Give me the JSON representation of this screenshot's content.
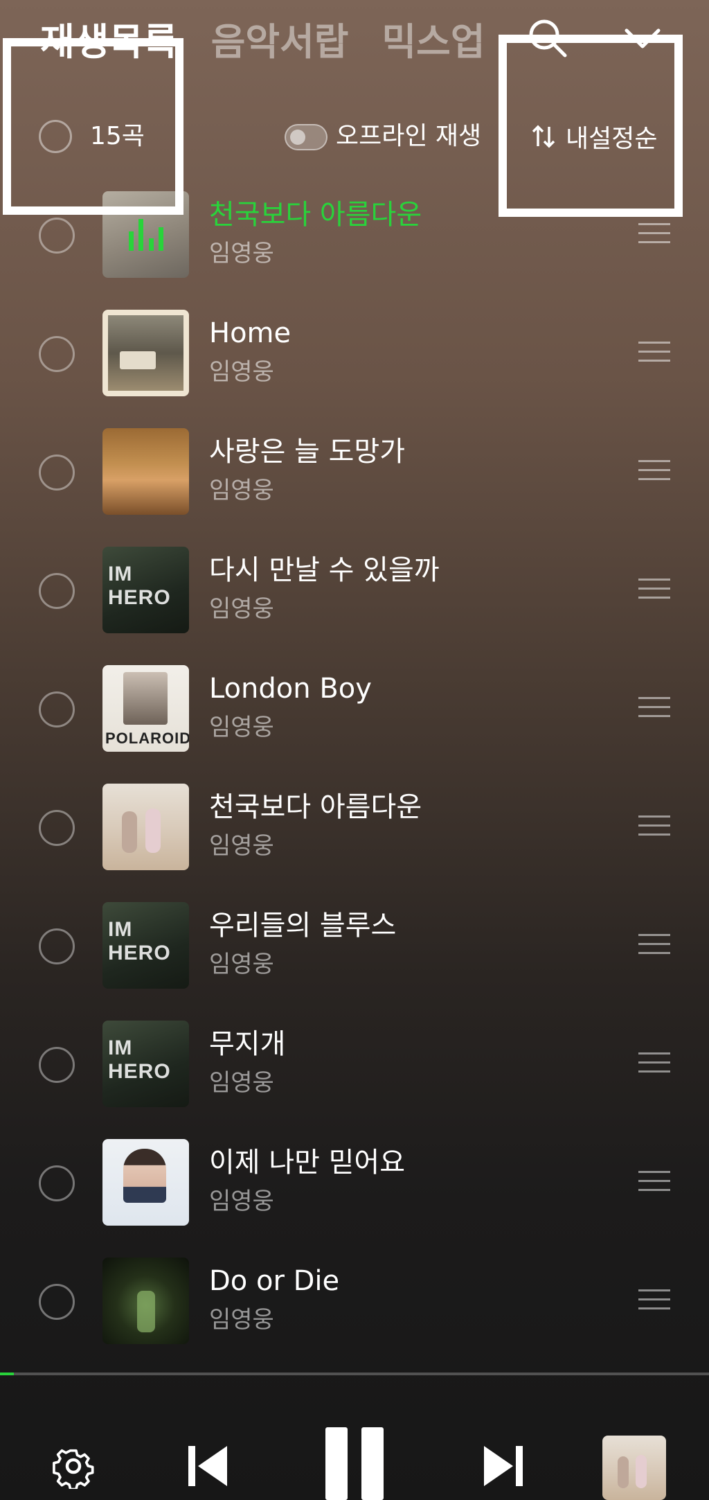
{
  "tabs": [
    {
      "label": "재생목록",
      "active": true
    },
    {
      "label": "음악서랍",
      "active": false
    },
    {
      "label": "믹스업",
      "active": false
    }
  ],
  "header": {
    "search_icon": "search-icon",
    "collapse_icon": "chevron-down-icon"
  },
  "list_header": {
    "count_label": "15곡",
    "offline_label": "오프라인 재생",
    "offline_enabled": false,
    "sort_label": "내설정순"
  },
  "tracks": [
    {
      "title": "천국보다 아름다운",
      "artist": "임영웅",
      "playing": true
    },
    {
      "title": "Home",
      "artist": "임영웅",
      "playing": false
    },
    {
      "title": "사랑은 늘 도망가",
      "artist": "임영웅",
      "playing": false
    },
    {
      "title": "다시 만날 수 있을까",
      "artist": "임영웅",
      "playing": false,
      "album_text": "IM HERO"
    },
    {
      "title": "London Boy",
      "artist": "임영웅",
      "playing": false,
      "album_text": "POLAROID"
    },
    {
      "title": "천국보다 아름다운",
      "artist": "임영웅",
      "playing": false
    },
    {
      "title": "우리들의 블루스",
      "artist": "임영웅",
      "playing": false,
      "album_text": "IM HERO"
    },
    {
      "title": "무지개",
      "artist": "임영웅",
      "playing": false,
      "album_text": "IM HERO"
    },
    {
      "title": "이제 나만 믿어요",
      "artist": "임영웅",
      "playing": false
    },
    {
      "title": "Do or Die",
      "artist": "임영웅",
      "playing": false
    }
  ],
  "player": {
    "progress": 0.02,
    "accent_color": "#29d33b"
  }
}
